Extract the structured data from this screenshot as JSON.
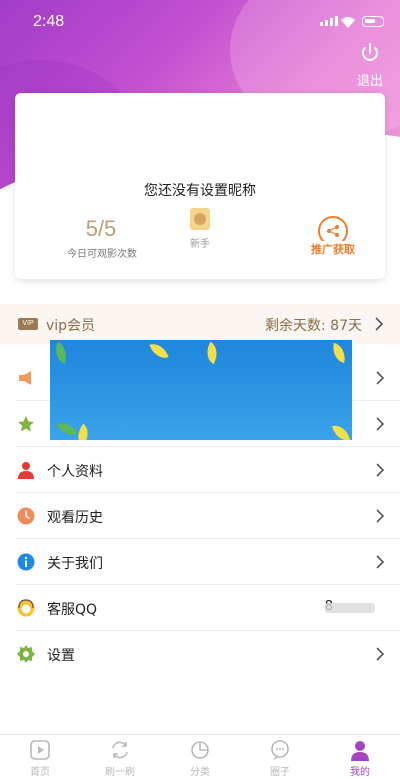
{
  "status_bar": {
    "time": "2:48"
  },
  "header": {
    "logout_label": "退出"
  },
  "profile": {
    "nickname": "您还没有设置昵称",
    "watch_count": "5/5",
    "watch_count_label": "今日可观影次数",
    "level_label": "新手",
    "promo_label": "推广获取"
  },
  "vip": {
    "label": "vip会员",
    "remaining": "剩余天数: 87天"
  },
  "menu": {
    "items": [
      {
        "label": "",
        "icon": "megaphone-icon"
      },
      {
        "label": "",
        "icon": "star-icon"
      },
      {
        "label": "个人资料",
        "icon": "person-icon"
      },
      {
        "label": "观看历史",
        "icon": "clock-icon"
      },
      {
        "label": "关于我们",
        "icon": "info-icon"
      },
      {
        "label": "客服QQ",
        "icon": "support-icon",
        "value": "8"
      },
      {
        "label": "设置",
        "icon": "gear-icon"
      }
    ]
  },
  "tabs": [
    {
      "label": "首页",
      "icon": "play-icon"
    },
    {
      "label": "刷一刷",
      "icon": "refresh-icon"
    },
    {
      "label": "分类",
      "icon": "pie-icon"
    },
    {
      "label": "圈子",
      "icon": "chat-icon"
    },
    {
      "label": "我的",
      "icon": "user-icon",
      "active": true
    }
  ],
  "colors": {
    "accent": "#a546c0",
    "vip_text": "#8a6d4b",
    "promo": "#f07d2b"
  }
}
